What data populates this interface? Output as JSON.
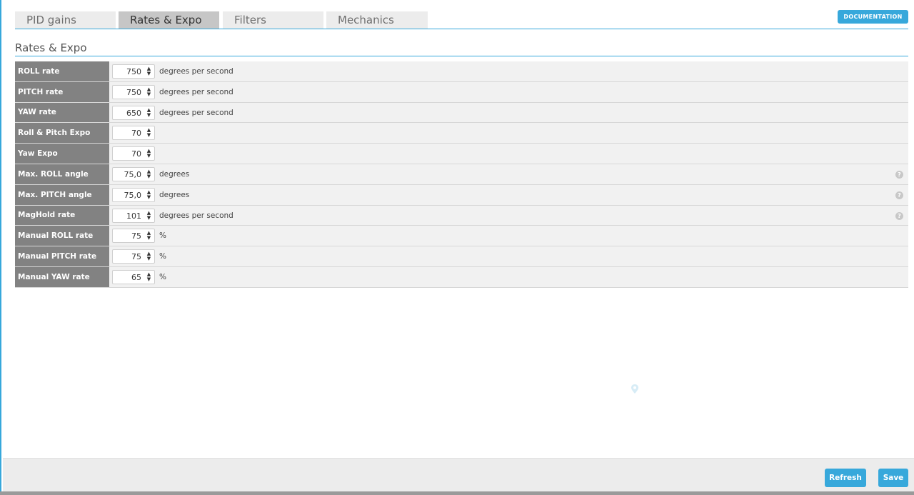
{
  "tabs": [
    {
      "label": "PID gains",
      "active": false
    },
    {
      "label": "Rates & Expo",
      "active": true
    },
    {
      "label": "Filters",
      "active": false
    },
    {
      "label": "Mechanics",
      "active": false
    }
  ],
  "documentation_label": "DOCUMENTATION",
  "section_title": "Rates & Expo",
  "rows": [
    {
      "label": "ROLL rate",
      "value": "750",
      "unit": "degrees per second",
      "help": false
    },
    {
      "label": "PITCH rate",
      "value": "750",
      "unit": "degrees per second",
      "help": false
    },
    {
      "label": "YAW rate",
      "value": "650",
      "unit": "degrees per second",
      "help": false
    },
    {
      "label": "Roll & Pitch Expo",
      "value": "70",
      "unit": "",
      "help": false
    },
    {
      "label": "Yaw Expo",
      "value": "70",
      "unit": "",
      "help": false
    },
    {
      "label": "Max. ROLL angle",
      "value": "75,0",
      "unit": "degrees",
      "help": true
    },
    {
      "label": "Max. PITCH angle",
      "value": "75,0",
      "unit": "degrees",
      "help": true
    },
    {
      "label": "MagHold rate",
      "value": "101",
      "unit": "degrees per second",
      "help": true
    },
    {
      "label": "Manual ROLL rate",
      "value": "75",
      "unit": "%",
      "help": false
    },
    {
      "label": "Manual PITCH rate",
      "value": "75",
      "unit": "%",
      "help": false
    },
    {
      "label": "Manual YAW rate",
      "value": "65",
      "unit": "%",
      "help": false
    }
  ],
  "footer": {
    "refresh_label": "Refresh",
    "save_label": "Save"
  },
  "colors": {
    "accent": "#37a8db",
    "label_bg": "#828282",
    "row_bg": "#f1f1f1"
  }
}
